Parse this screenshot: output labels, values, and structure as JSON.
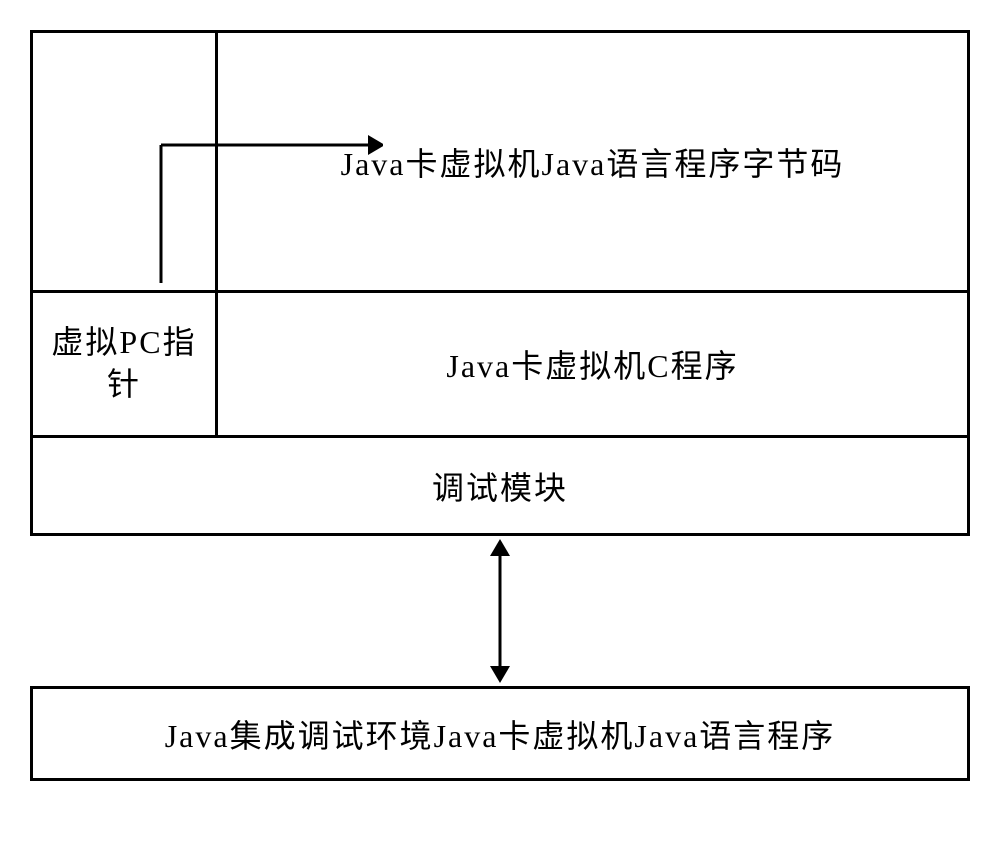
{
  "diagram": {
    "top_right": "Java卡虚拟机Java语言程序字节码",
    "middle_left": "虚拟PC指\n针",
    "middle_right": "Java卡虚拟机C程序",
    "upper_bottom": "调试模块",
    "lower_box": "Java集成调试环境Java卡虚拟机Java语言程序"
  }
}
